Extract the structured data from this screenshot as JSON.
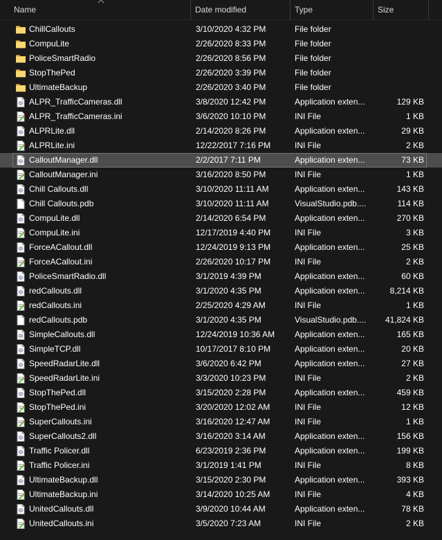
{
  "columns": {
    "name": "Name",
    "date_modified": "Date modified",
    "type": "Type",
    "size": "Size"
  },
  "files": [
    {
      "name": "ChillCallouts",
      "date": "3/10/2020 4:32 PM",
      "type": "File folder",
      "size": "",
      "icon": "folder-icon"
    },
    {
      "name": "CompuLite",
      "date": "2/26/2020 8:33 PM",
      "type": "File folder",
      "size": "",
      "icon": "folder-icon"
    },
    {
      "name": "PoliceSmartRadio",
      "date": "2/26/2020 8:56 PM",
      "type": "File folder",
      "size": "",
      "icon": "folder-icon"
    },
    {
      "name": "StopThePed",
      "date": "2/26/2020 3:39 PM",
      "type": "File folder",
      "size": "",
      "icon": "folder-icon"
    },
    {
      "name": "UltimateBackup",
      "date": "2/26/2020 3:40 PM",
      "type": "File folder",
      "size": "",
      "icon": "folder-icon"
    },
    {
      "name": "ALPR_TrafficCameras.dll",
      "date": "3/8/2020 12:42 PM",
      "type": "Application exten...",
      "size": "129 KB",
      "icon": "dll-file-icon"
    },
    {
      "name": "ALPR_TrafficCameras.ini",
      "date": "3/6/2020 10:10 PM",
      "type": "INI File",
      "size": "1 KB",
      "icon": "ini-file-icon"
    },
    {
      "name": "ALPRLite.dll",
      "date": "2/14/2020 8:26 PM",
      "type": "Application exten...",
      "size": "29 KB",
      "icon": "dll-file-icon"
    },
    {
      "name": "ALPRLite.ini",
      "date": "12/22/2017 7:16 PM",
      "type": "INI File",
      "size": "2 KB",
      "icon": "ini-file-icon"
    },
    {
      "name": "CalloutManager.dll",
      "date": "2/2/2017 7:11 PM",
      "type": "Application exten...",
      "size": "73 KB",
      "icon": "dll-file-icon",
      "selected": true
    },
    {
      "name": "CalloutManager.ini",
      "date": "3/16/2020 8:50 PM",
      "type": "INI File",
      "size": "1 KB",
      "icon": "ini-file-icon"
    },
    {
      "name": "Chill Callouts.dll",
      "date": "3/10/2020 11:11 AM",
      "type": "Application exten...",
      "size": "143 KB",
      "icon": "dll-file-icon"
    },
    {
      "name": "Chill Callouts.pdb",
      "date": "3/10/2020 11:11 AM",
      "type": "VisualStudio.pdb....",
      "size": "114 KB",
      "icon": "pdb-file-icon"
    },
    {
      "name": "CompuLite.dll",
      "date": "2/14/2020 6:54 PM",
      "type": "Application exten...",
      "size": "270 KB",
      "icon": "dll-file-icon"
    },
    {
      "name": "CompuLite.ini",
      "date": "12/17/2019 4:40 PM",
      "type": "INI File",
      "size": "3 KB",
      "icon": "ini-file-icon"
    },
    {
      "name": "ForceACallout.dll",
      "date": "12/24/2019 9:13 PM",
      "type": "Application exten...",
      "size": "25 KB",
      "icon": "dll-file-icon"
    },
    {
      "name": "ForceACallout.ini",
      "date": "2/26/2020 10:17 PM",
      "type": "INI File",
      "size": "2 KB",
      "icon": "ini-file-icon"
    },
    {
      "name": "PoliceSmartRadio.dll",
      "date": "3/1/2019 4:39 PM",
      "type": "Application exten...",
      "size": "60 KB",
      "icon": "dll-file-icon"
    },
    {
      "name": "redCallouts.dll",
      "date": "3/1/2020 4:35 PM",
      "type": "Application exten...",
      "size": "8,214 KB",
      "icon": "dll-file-icon"
    },
    {
      "name": "redCallouts.ini",
      "date": "2/25/2020 4:29 AM",
      "type": "INI File",
      "size": "1 KB",
      "icon": "ini-file-icon"
    },
    {
      "name": "redCallouts.pdb",
      "date": "3/1/2020 4:35 PM",
      "type": "VisualStudio.pdb....",
      "size": "41,824 KB",
      "icon": "pdb-file-icon"
    },
    {
      "name": "SimpleCallouts.dll",
      "date": "12/24/2019 10:36 AM",
      "type": "Application exten...",
      "size": "165 KB",
      "icon": "dll-file-icon"
    },
    {
      "name": "SimpleTCP.dll",
      "date": "10/17/2017 8:10 PM",
      "type": "Application exten...",
      "size": "20 KB",
      "icon": "dll-file-icon"
    },
    {
      "name": "SpeedRadarLite.dll",
      "date": "3/6/2020 6:42 PM",
      "type": "Application exten...",
      "size": "27 KB",
      "icon": "dll-file-icon"
    },
    {
      "name": "SpeedRadarLite.ini",
      "date": "3/3/2020 10:23 PM",
      "type": "INI File",
      "size": "2 KB",
      "icon": "ini-file-icon"
    },
    {
      "name": "StopThePed.dll",
      "date": "3/15/2020 2:28 PM",
      "type": "Application exten...",
      "size": "459 KB",
      "icon": "dll-file-icon"
    },
    {
      "name": "StopThePed.ini",
      "date": "3/20/2020 12:02 AM",
      "type": "INI File",
      "size": "12 KB",
      "icon": "ini-file-icon"
    },
    {
      "name": "SuperCallouts.ini",
      "date": "3/16/2020 12:47 AM",
      "type": "INI File",
      "size": "1 KB",
      "icon": "ini-file-icon"
    },
    {
      "name": "SuperCallouts2.dll",
      "date": "3/16/2020 3:14 AM",
      "type": "Application exten...",
      "size": "156 KB",
      "icon": "dll-file-icon"
    },
    {
      "name": "Traffic Policer.dll",
      "date": "6/23/2019 2:36 PM",
      "type": "Application exten...",
      "size": "199 KB",
      "icon": "dll-file-icon"
    },
    {
      "name": "Traffic Policer.ini",
      "date": "3/1/2019 1:41 PM",
      "type": "INI File",
      "size": "8 KB",
      "icon": "ini-file-icon"
    },
    {
      "name": "UltimateBackup.dll",
      "date": "3/15/2020 2:30 PM",
      "type": "Application exten...",
      "size": "393 KB",
      "icon": "dll-file-icon"
    },
    {
      "name": "UltimateBackup.ini",
      "date": "3/14/2020 10:25 AM",
      "type": "INI File",
      "size": "4 KB",
      "icon": "ini-file-icon"
    },
    {
      "name": "UnitedCallouts.dll",
      "date": "3/9/2020 10:44 AM",
      "type": "Application exten...",
      "size": "78 KB",
      "icon": "dll-file-icon"
    },
    {
      "name": "UnitedCallouts.ini",
      "date": "3/5/2020 7:23 AM",
      "type": "INI File",
      "size": "2 KB",
      "icon": "ini-file-icon"
    }
  ],
  "colors": {
    "background": "#191919",
    "selected_row": "#4d4d4d",
    "folder_yellow": "#f8d775",
    "text": "#ffffff",
    "header_text": "#dcdcdc"
  }
}
